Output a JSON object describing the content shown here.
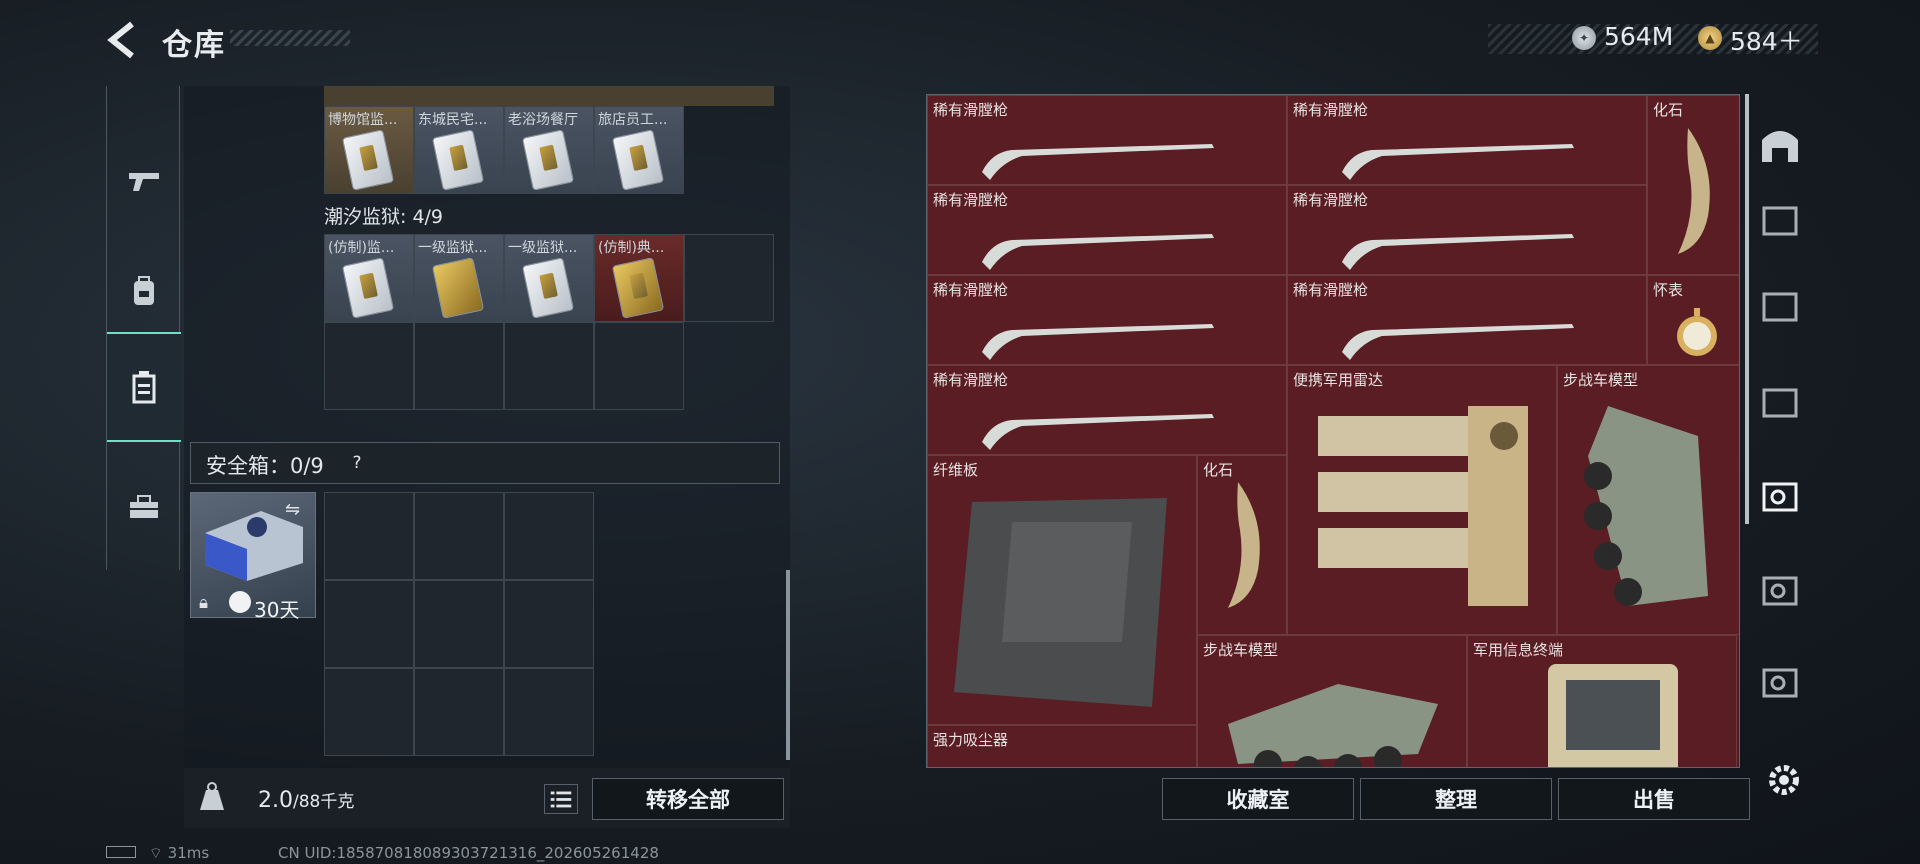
{
  "header": {
    "title": "仓库",
    "currency_silver": "564M",
    "currency_gold": "584＋"
  },
  "inventory": {
    "row1": [
      {
        "label": "博物馆监..."
      },
      {
        "label": "东城民宅..."
      },
      {
        "label": "老浴场餐厅"
      },
      {
        "label": "旅店员工..."
      }
    ],
    "prison_label": "潮汐监狱: 4/9",
    "row2": [
      {
        "label": "(仿制)监..."
      },
      {
        "label": "一级监狱..."
      },
      {
        "label": "一级监狱..."
      },
      {
        "label": "(仿制)典..."
      }
    ],
    "safe_label": "安全箱：0/9",
    "help": "?",
    "safe_time": "30天",
    "weight_value": "2.0",
    "weight_unit": "/88千克",
    "transfer_all": "转移全部"
  },
  "stash": {
    "items": [
      {
        "label": "稀有滑膛枪"
      },
      {
        "label": "稀有滑膛枪"
      },
      {
        "label": "化石"
      },
      {
        "label": "稀有滑膛枪"
      },
      {
        "label": "稀有滑膛枪"
      },
      {
        "label": "稀有滑膛枪"
      },
      {
        "label": "稀有滑膛枪"
      },
      {
        "label": "怀表"
      },
      {
        "label": "稀有滑膛枪"
      },
      {
        "label": "便携军用雷达"
      },
      {
        "label": "步战车模型"
      },
      {
        "label": "纤维板"
      },
      {
        "label": "化石"
      },
      {
        "label": "步战车模型"
      },
      {
        "label": "军用信息终端"
      },
      {
        "label": "强力吸尘器"
      }
    ]
  },
  "buttons": {
    "collection": "收藏室",
    "sort": "整理",
    "sell": "出售"
  },
  "status": {
    "ping": "31ms",
    "uid": "CN UID:1858708180893037213​16_202605261428"
  },
  "colors": {
    "accent": "#6fe0c8",
    "stash_bg": "#4e1e22"
  }
}
